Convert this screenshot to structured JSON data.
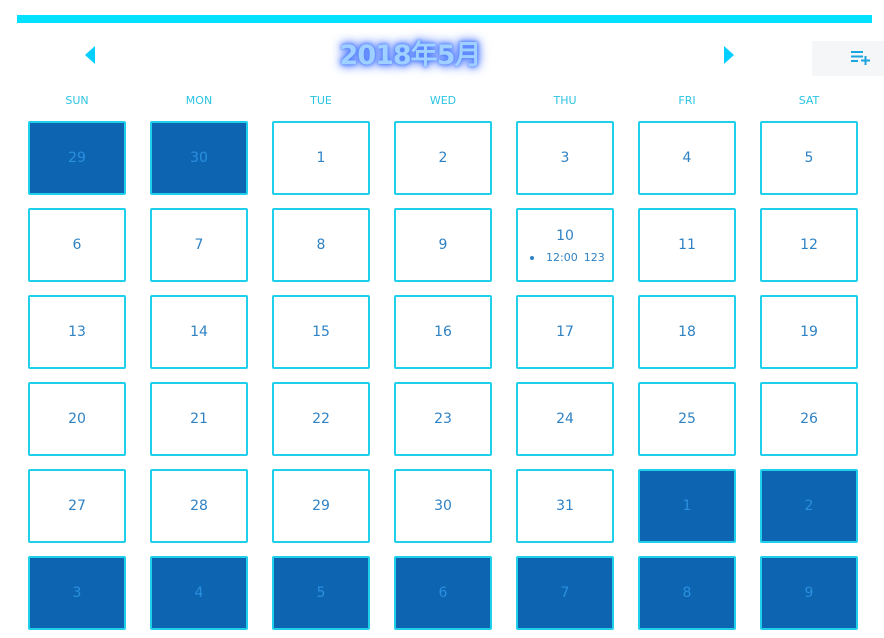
{
  "header": {
    "title": "2018年5月",
    "prev_icon": "caret-left-icon",
    "next_icon": "caret-right-icon",
    "add_icon": "playlist-add-icon",
    "accent": "#00e0ff",
    "title_color": "#9fd0ff"
  },
  "weekdays": [
    "SUN",
    "MON",
    "TUE",
    "WED",
    "THU",
    "FRI",
    "SAT"
  ],
  "weeks": [
    [
      {
        "day": "29",
        "other": true
      },
      {
        "day": "30",
        "other": true
      },
      {
        "day": "1"
      },
      {
        "day": "2"
      },
      {
        "day": "3"
      },
      {
        "day": "4"
      },
      {
        "day": "5"
      }
    ],
    [
      {
        "day": "6"
      },
      {
        "day": "7"
      },
      {
        "day": "8"
      },
      {
        "day": "9"
      },
      {
        "day": "10",
        "event": {
          "time": "12:00",
          "title": "123"
        }
      },
      {
        "day": "11"
      },
      {
        "day": "12"
      }
    ],
    [
      {
        "day": "13"
      },
      {
        "day": "14"
      },
      {
        "day": "15"
      },
      {
        "day": "16"
      },
      {
        "day": "17"
      },
      {
        "day": "18"
      },
      {
        "day": "19"
      }
    ],
    [
      {
        "day": "20"
      },
      {
        "day": "21"
      },
      {
        "day": "22"
      },
      {
        "day": "23"
      },
      {
        "day": "24"
      },
      {
        "day": "25"
      },
      {
        "day": "26"
      }
    ],
    [
      {
        "day": "27"
      },
      {
        "day": "28"
      },
      {
        "day": "29"
      },
      {
        "day": "30"
      },
      {
        "day": "31"
      },
      {
        "day": "1",
        "other": true
      },
      {
        "day": "2",
        "other": true
      }
    ],
    [
      {
        "day": "3",
        "other": true
      },
      {
        "day": "4",
        "other": true
      },
      {
        "day": "5",
        "other": true
      },
      {
        "day": "6",
        "other": true
      },
      {
        "day": "7",
        "other": true
      },
      {
        "day": "8",
        "other": true
      },
      {
        "day": "9",
        "other": true
      }
    ]
  ],
  "colors": {
    "cell_border": "#20d0ea",
    "other_month_fill": "#0d64b0",
    "day_text": "#2f82c4"
  }
}
